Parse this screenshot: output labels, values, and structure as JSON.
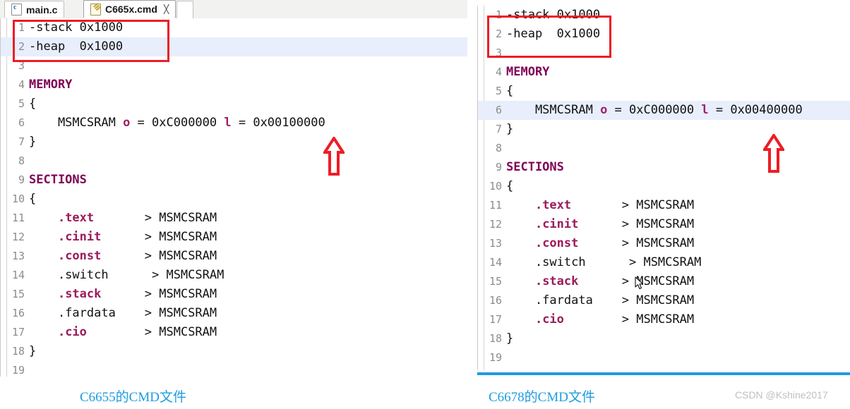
{
  "tabs": [
    {
      "label": "main.c",
      "icon": "c-file-icon",
      "active": false,
      "closable": false
    },
    {
      "label": "C665x.cmd",
      "icon": "cmd-file-icon",
      "active": true,
      "closable": true,
      "close_glyph": "╳"
    }
  ],
  "left_editor": {
    "title": "C6655 linker command file",
    "highlight_line": 2,
    "lines": [
      {
        "n": "1",
        "segs": [
          {
            "t": "-stack 0x1000",
            "c": "plain"
          }
        ]
      },
      {
        "n": "2",
        "segs": [
          {
            "t": "-heap  0x1000",
            "c": "plain"
          }
        ]
      },
      {
        "n": "3",
        "segs": [
          {
            "t": "",
            "c": "plain"
          }
        ]
      },
      {
        "n": "4",
        "segs": [
          {
            "t": "MEMORY",
            "c": "kw"
          }
        ]
      },
      {
        "n": "5",
        "segs": [
          {
            "t": "{",
            "c": "plain"
          }
        ]
      },
      {
        "n": "6",
        "segs": [
          {
            "t": "    MSMCSRAM ",
            "c": "plain"
          },
          {
            "t": "o",
            "c": "attr"
          },
          {
            "t": " = 0xC000000 ",
            "c": "plain"
          },
          {
            "t": "l",
            "c": "attr"
          },
          {
            "t": " = 0x00100000",
            "c": "plain"
          }
        ]
      },
      {
        "n": "7",
        "segs": [
          {
            "t": "}",
            "c": "plain"
          }
        ]
      },
      {
        "n": "8",
        "segs": [
          {
            "t": "",
            "c": "plain"
          }
        ]
      },
      {
        "n": "9",
        "segs": [
          {
            "t": "SECTIONS",
            "c": "kw"
          }
        ]
      },
      {
        "n": "10",
        "segs": [
          {
            "t": "{",
            "c": "plain"
          }
        ]
      },
      {
        "n": "11",
        "segs": [
          {
            "t": "    ",
            "c": "plain"
          },
          {
            "t": ".text   ",
            "c": "sec"
          },
          {
            "t": "    > MSMCSRAM",
            "c": "plain"
          }
        ]
      },
      {
        "n": "12",
        "segs": [
          {
            "t": "    ",
            "c": "plain"
          },
          {
            "t": ".cinit  ",
            "c": "sec"
          },
          {
            "t": "    > MSMCSRAM",
            "c": "plain"
          }
        ]
      },
      {
        "n": "13",
        "segs": [
          {
            "t": "    ",
            "c": "plain"
          },
          {
            "t": ".const  ",
            "c": "sec"
          },
          {
            "t": "    > MSMCSRAM",
            "c": "plain"
          }
        ]
      },
      {
        "n": "14",
        "segs": [
          {
            "t": "    .switch      > MSMCSRAM",
            "c": "plain"
          }
        ]
      },
      {
        "n": "15",
        "segs": [
          {
            "t": "    ",
            "c": "plain"
          },
          {
            "t": ".stack  ",
            "c": "sec"
          },
          {
            "t": "    > MSMCSRAM",
            "c": "plain"
          }
        ]
      },
      {
        "n": "16",
        "segs": [
          {
            "t": "    .fardata    > MSMCSRAM",
            "c": "plain"
          }
        ]
      },
      {
        "n": "17",
        "segs": [
          {
            "t": "    ",
            "c": "plain"
          },
          {
            "t": ".cio    ",
            "c": "sec"
          },
          {
            "t": "    > MSMCSRAM",
            "c": "plain"
          }
        ]
      },
      {
        "n": "18",
        "segs": [
          {
            "t": "}",
            "c": "plain"
          }
        ]
      },
      {
        "n": "19",
        "segs": [
          {
            "t": "",
            "c": "plain"
          }
        ]
      }
    ]
  },
  "right_editor": {
    "title": "C6678 linker command file",
    "highlight_line": 6,
    "lines": [
      {
        "n": "1",
        "segs": [
          {
            "t": "-stack 0x1000",
            "c": "plain"
          }
        ]
      },
      {
        "n": "2",
        "segs": [
          {
            "t": "-heap  0x1000",
            "c": "plain"
          }
        ]
      },
      {
        "n": "3",
        "segs": [
          {
            "t": "",
            "c": "plain"
          }
        ]
      },
      {
        "n": "4",
        "segs": [
          {
            "t": "MEMORY",
            "c": "kw"
          }
        ]
      },
      {
        "n": "5",
        "segs": [
          {
            "t": "{",
            "c": "plain"
          }
        ]
      },
      {
        "n": "6",
        "segs": [
          {
            "t": "    MSMCSRAM ",
            "c": "plain"
          },
          {
            "t": "o",
            "c": "attr"
          },
          {
            "t": " = 0xC000000 ",
            "c": "plain"
          },
          {
            "t": "l",
            "c": "attr"
          },
          {
            "t": " = 0x00400000",
            "c": "plain"
          }
        ]
      },
      {
        "n": "7",
        "segs": [
          {
            "t": "}",
            "c": "plain"
          }
        ]
      },
      {
        "n": "8",
        "segs": [
          {
            "t": "",
            "c": "plain"
          }
        ]
      },
      {
        "n": "9",
        "segs": [
          {
            "t": "SECTIONS",
            "c": "kw"
          }
        ]
      },
      {
        "n": "10",
        "segs": [
          {
            "t": "{",
            "c": "plain"
          }
        ]
      },
      {
        "n": "11",
        "segs": [
          {
            "t": "    ",
            "c": "plain"
          },
          {
            "t": ".text   ",
            "c": "sec"
          },
          {
            "t": "    > MSMCSRAM",
            "c": "plain"
          }
        ]
      },
      {
        "n": "12",
        "segs": [
          {
            "t": "    ",
            "c": "plain"
          },
          {
            "t": ".cinit  ",
            "c": "sec"
          },
          {
            "t": "    > MSMCSRAM",
            "c": "plain"
          }
        ]
      },
      {
        "n": "13",
        "segs": [
          {
            "t": "    ",
            "c": "plain"
          },
          {
            "t": ".const  ",
            "c": "sec"
          },
          {
            "t": "    > MSMCSRAM",
            "c": "plain"
          }
        ]
      },
      {
        "n": "14",
        "segs": [
          {
            "t": "    .switch      > MSMCSRAM",
            "c": "plain"
          }
        ]
      },
      {
        "n": "15",
        "segs": [
          {
            "t": "    ",
            "c": "plain"
          },
          {
            "t": ".stack  ",
            "c": "sec"
          },
          {
            "t": "    > MSMCSRAM",
            "c": "plain"
          }
        ]
      },
      {
        "n": "16",
        "segs": [
          {
            "t": "    .fardata    > MSMCSRAM",
            "c": "plain"
          }
        ]
      },
      {
        "n": "17",
        "segs": [
          {
            "t": "    ",
            "c": "plain"
          },
          {
            "t": ".cio    ",
            "c": "sec"
          },
          {
            "t": "    > MSMCSRAM",
            "c": "plain"
          }
        ]
      },
      {
        "n": "18",
        "segs": [
          {
            "t": "}",
            "c": "plain"
          }
        ]
      },
      {
        "n": "19",
        "segs": [
          {
            "t": "",
            "c": "plain"
          }
        ]
      }
    ]
  },
  "annotations": {
    "left_caption": "C6655的CMD文件",
    "right_caption": "C6678的CMD文件",
    "watermark": "CSDN @Kshine2017",
    "redbox_color": "#ee1c25",
    "arrow_color": "#ee1c25",
    "caption_color": "#1e9ce0",
    "highlight_color": "#e8eefb"
  }
}
